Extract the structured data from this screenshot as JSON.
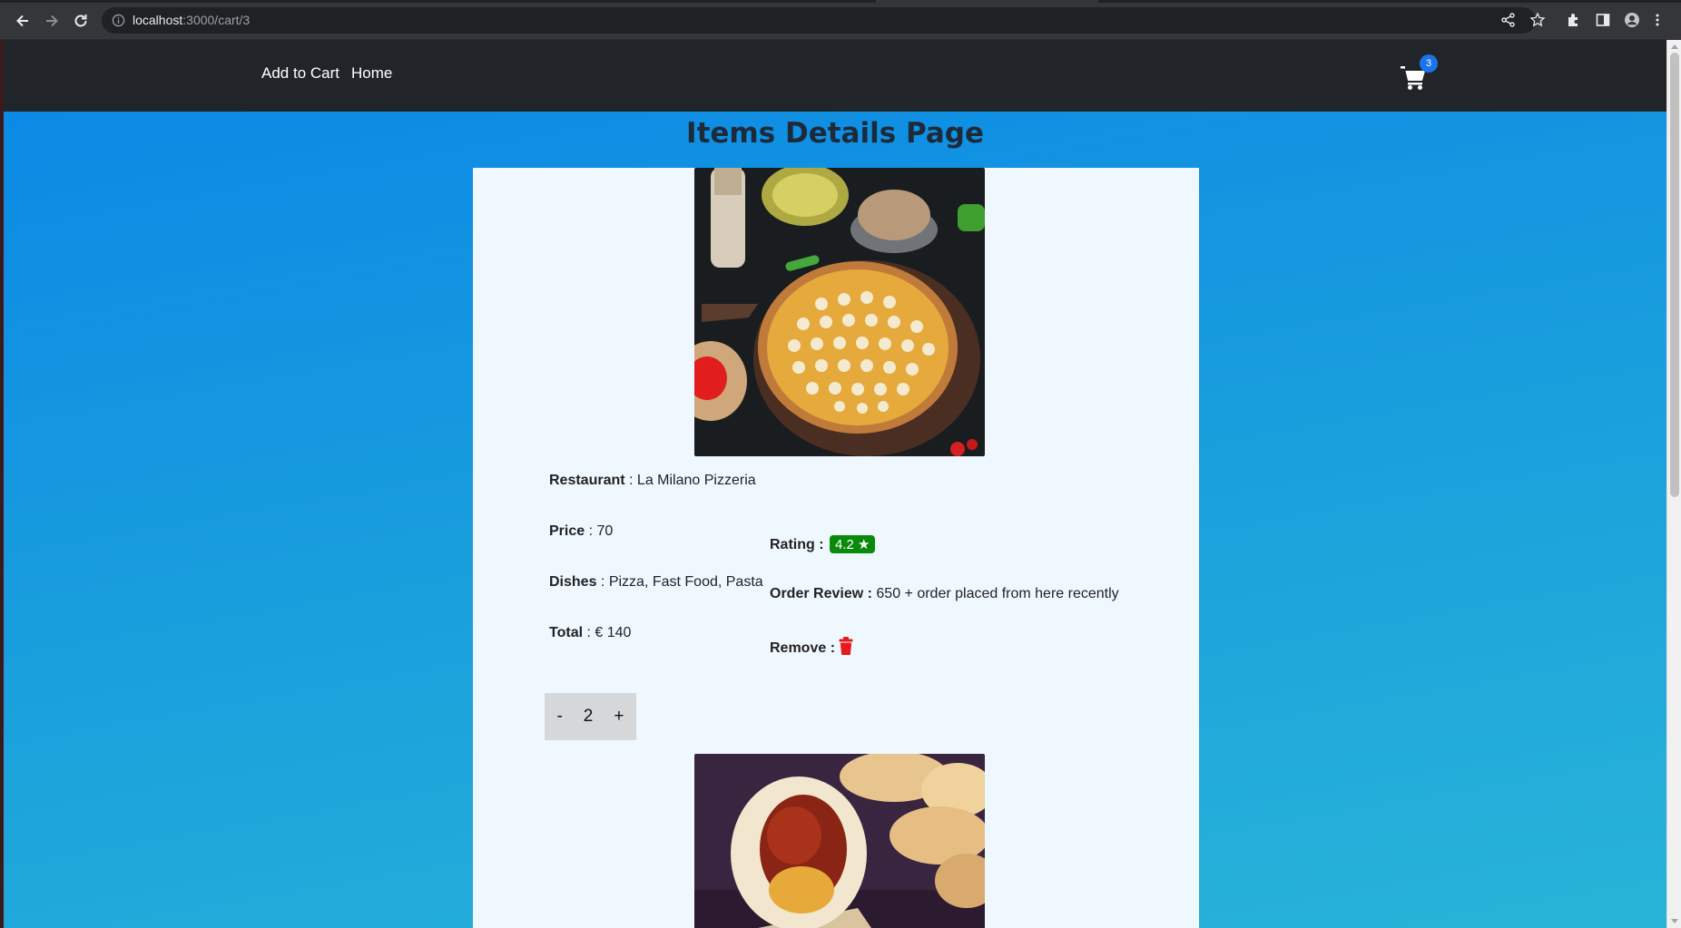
{
  "browser": {
    "url_host": "localhost",
    "url_path": ":3000/cart/3"
  },
  "navbar": {
    "links": [
      "Add to Cart",
      "Home"
    ],
    "cart_count": "3"
  },
  "page": {
    "title": "Items Details Page"
  },
  "item": {
    "restaurant_label": "Restaurant",
    "restaurant": "La Milano Pizzeria",
    "price_label": "Price",
    "price": "70",
    "dishes_label": "Dishes",
    "dishes": "Pizza, Fast Food, Pasta",
    "total_label": "Total",
    "total": "€ 140",
    "rating_label": "Rating :",
    "rating": "4.2 ★",
    "order_review_label": "Order Review :",
    "order_review": "650 + order placed from here recently",
    "remove_label": "Remove :",
    "quantity": "2",
    "decrement": "-",
    "increment": "+"
  },
  "colors": {
    "navbar_bg": "#212529",
    "card_bg": "#f0f8ff",
    "rating_badge": "#0a8a0a",
    "remove_icon": "#e31b1b",
    "cart_badge": "#1a73e8"
  }
}
